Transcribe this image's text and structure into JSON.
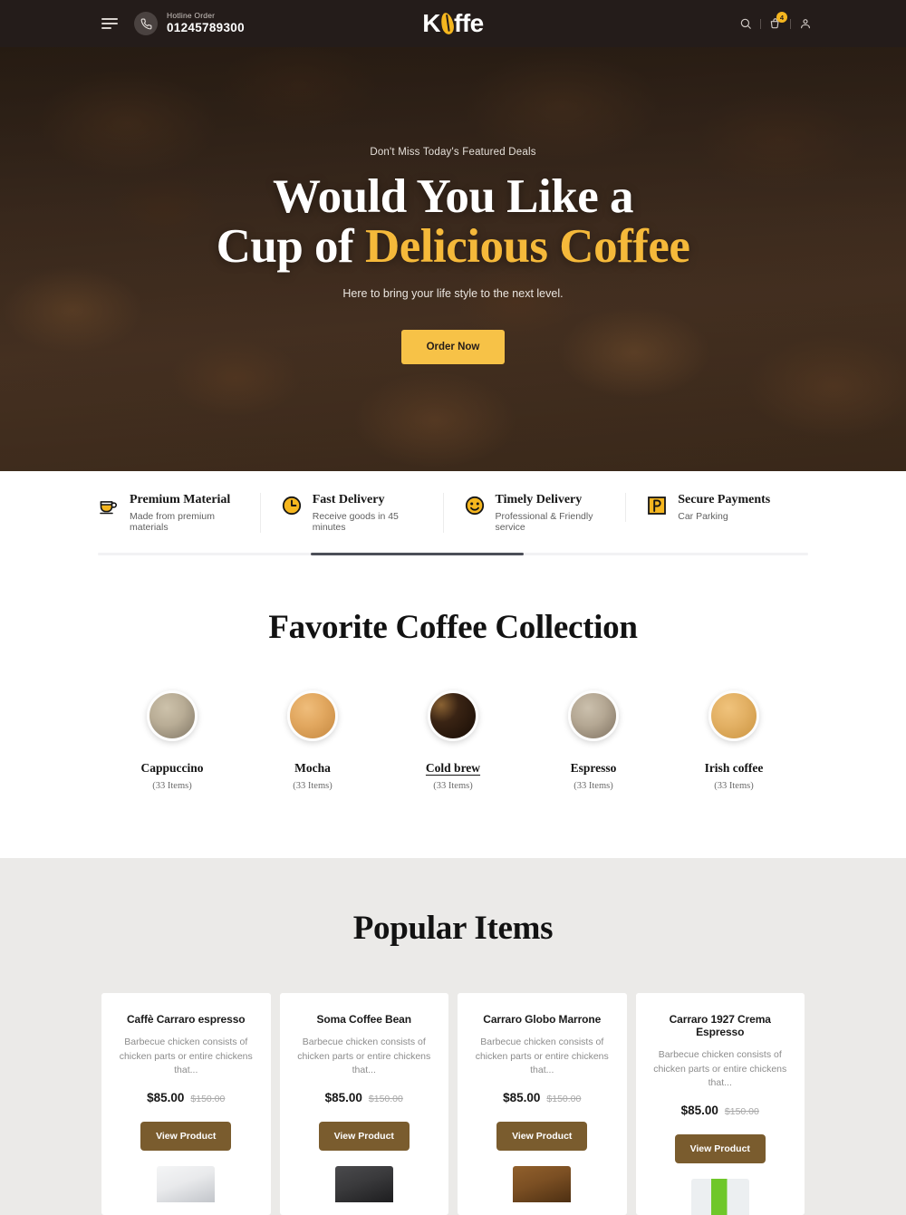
{
  "topbar": {
    "menu_icon": "hamburger-icon",
    "hotline_label": "Hotline Order",
    "hotline_number": "01245789300",
    "logo_text_before": "K",
    "logo_text_after": "ffe",
    "search_icon": "search-icon",
    "cart_icon": "cart-icon",
    "cart_count": "4",
    "account_icon": "user-icon",
    "bg": "#241c1a",
    "accent": "#f5b61f"
  },
  "hero": {
    "eyebrow": "Don't Miss Today's Featured Deals",
    "title_line1": "Would You Like a",
    "title_line2_plain": "Cup of ",
    "title_line2_highlight": "Delicious Coffee",
    "subtitle": "Here to bring your life style to the next level.",
    "cta_label": "Order Now",
    "cta_color": "#f7c247",
    "highlight_color": "#f5b93a"
  },
  "features": [
    {
      "icon": "coffee-cup-icon",
      "title": "Premium Material",
      "desc": "Made from premium materials"
    },
    {
      "icon": "clock-icon",
      "title": "Fast Delivery",
      "desc": "Receive goods in 45 minutes"
    },
    {
      "icon": "smiley-icon",
      "title": "Timely Delivery",
      "desc": "Professional & Friendly service"
    },
    {
      "icon": "parking-icon",
      "title": "Secure Payments",
      "desc": "Car Parking"
    }
  ],
  "collection": {
    "title": "Favorite Coffee Collection",
    "items": [
      {
        "name": "Cappuccino",
        "count": "(33 Items)",
        "active": false,
        "color_a": "#b9ad96",
        "color_b": "#7e7463"
      },
      {
        "name": "Mocha",
        "count": "(33 Items)",
        "active": false,
        "color_a": "#e2a860",
        "color_b": "#c4873f"
      },
      {
        "name": "Cold brew",
        "count": "(33 Items)",
        "active": true,
        "color_a": "#3a2414",
        "color_b": "#170c05"
      },
      {
        "name": "Espresso",
        "count": "(33 Items)",
        "active": false,
        "color_a": "#b5a894",
        "color_b": "#7d705f"
      },
      {
        "name": "Irish coffee",
        "count": "(33 Items)",
        "active": false,
        "color_a": "#e3b165",
        "color_b": "#cb9440"
      }
    ]
  },
  "popular": {
    "title": "Popular Items",
    "products": [
      {
        "name": "Caffè Carraro espresso",
        "desc": "Barbecue chicken consists of chicken parts or entire chickens that...",
        "price": "$85.00",
        "old_price": "$150.00",
        "button": "View Product",
        "img_a": "#e9eaec",
        "img_b": "#c2c5ca"
      },
      {
        "name": "Soma Coffee Bean",
        "desc": "Barbecue chicken consists of chicken parts or entire chickens that...",
        "price": "$85.00",
        "old_price": "$150.00",
        "button": "View Product",
        "img_a": "#3a3a3c",
        "img_b": "#1d1d1f"
      },
      {
        "name": "Carraro Globo Marrone",
        "desc": "Barbecue chicken consists of chicken parts or entire chickens that...",
        "price": "$85.00",
        "old_price": "$150.00",
        "button": "View Product",
        "img_a": "#7b4f23",
        "img_b": "#4d2f12"
      },
      {
        "name": "Carraro 1927 Crema Espresso",
        "desc": "Barbecue chicken consists of chicken parts or entire chickens that...",
        "price": "$85.00",
        "old_price": "$150.00",
        "button": "View Product",
        "img_a": "#6fc72a",
        "img_b": "#eceff1"
      }
    ]
  }
}
